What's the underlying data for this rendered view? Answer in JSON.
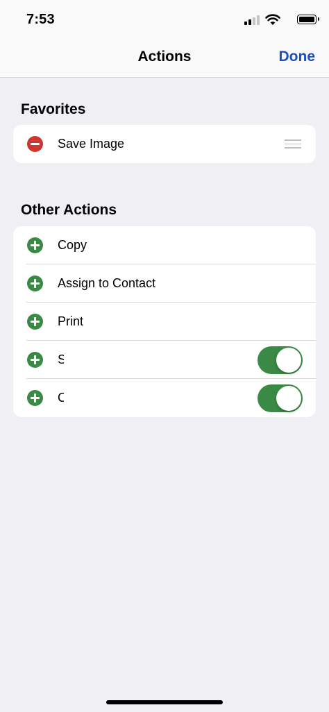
{
  "status_bar": {
    "time": "7:53"
  },
  "nav": {
    "title": "Actions",
    "done_label": "Done"
  },
  "favorites": {
    "header": "Favorites",
    "items": [
      {
        "label": "Save Image",
        "icon": "remove-circle-icon"
      }
    ]
  },
  "other_actions": {
    "header": "Other Actions",
    "items": [
      {
        "label": "Copy",
        "icon": "add-circle-icon"
      },
      {
        "label": "Assign to Contact",
        "icon": "add-circle-icon"
      },
      {
        "label": "Print",
        "icon": "add-circle-icon"
      },
      {
        "label": "S",
        "icon": "add-circle-icon",
        "toggle": true
      },
      {
        "label": "C",
        "icon": "add-circle-icon",
        "toggle": true
      }
    ]
  },
  "colors": {
    "accent": "#1b4fbf",
    "add": "#3a8a45",
    "remove": "#d0352e",
    "background": "#efeff4"
  }
}
